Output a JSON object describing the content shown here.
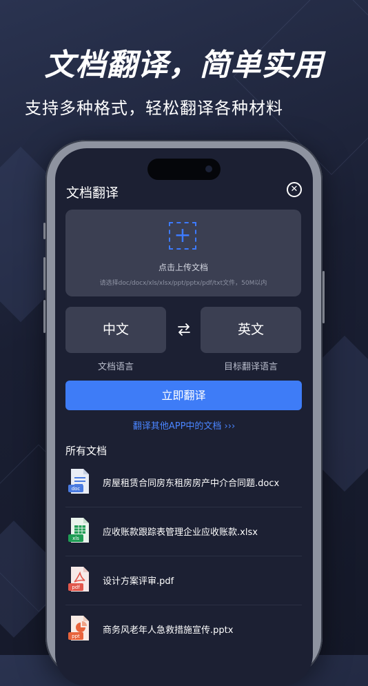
{
  "hero": {
    "title": "文档翻译，简单实用",
    "subtitle": "支持多种格式，轻松翻译各种材料"
  },
  "screen": {
    "title": "文档翻译",
    "upload": {
      "label": "点击上传文档",
      "hint": "请选择doc/docx/xls/xlsx/ppt/pptx/pdf/txt文件，50M以内"
    },
    "languages": {
      "source": "中文",
      "source_caption": "文档语言",
      "target": "英文",
      "target_caption": "目标翻译语言"
    },
    "translate_button": "立即翻译",
    "other_app_link": "翻译其他APP中的文档 ›››",
    "all_docs_title": "所有文档",
    "documents": [
      {
        "name": "房屋租赁合同房东租房房产中介合同题.docx",
        "type": "doc",
        "icon": "word-file-icon"
      },
      {
        "name": "应收账款跟踪表管理企业应收账款.xlsx",
        "type": "xls",
        "icon": "excel-file-icon"
      },
      {
        "name": "设计方案评审.pdf",
        "type": "pdf",
        "icon": "pdf-file-icon"
      },
      {
        "name": "商务风老年人急救措施宣传.pptx",
        "type": "ppt",
        "icon": "ppt-file-icon"
      }
    ]
  },
  "colors": {
    "accent": "#3e7cf7",
    "link": "#4a85ff",
    "card": "#3b3f52",
    "screen_bg": "#1c2033",
    "doc": "#4a7be0",
    "xls": "#1f9d55",
    "pdf": "#e2574c",
    "ppt": "#e8643c"
  }
}
